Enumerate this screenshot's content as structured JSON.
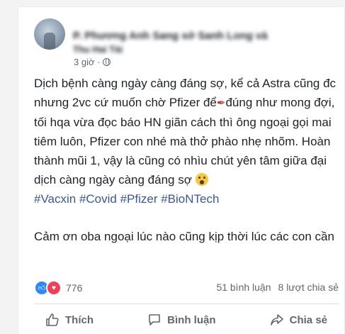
{
  "post": {
    "author_line1": "P. Phương Anh Sang sở Sanh Long và",
    "author_line2": "Thu Hai Tài",
    "time": "3 giờ ·",
    "paragraph1": "Dịch bệnh càng ngày càng đáng sợ, kể cả Astra cũng đc nhưng 2vc cứ muốn chờ Pfizer để",
    "paragraph1b": "đúng như mong đợi, tối hqa vừa đọc báo HN giãn cách thì ông ngoại gọi mai tiêm luôn, Pfizer con nhé mà thở phào nhẹ nhõm. Hoàn thành mũi 1, vậy là cũng có nhìu chút yên tâm giữa đại dịch càng ngày càng đáng sợ",
    "hashtags": "#Vacxin #Covid #Pfizer #BioNTech",
    "paragraph2": "Cảm ơn oba ngoại lúc nào cũng kịp thời lúc các con cần",
    "icons": [
      "globe-icon",
      "syringe-icon",
      "surprised-emoji-icon"
    ]
  },
  "stats": {
    "reaction_count": "776",
    "comments": "51 bình luận",
    "shares": "8 lượt chia sẻ",
    "icons": [
      "like-reaction-icon",
      "love-reaction-icon"
    ]
  },
  "actions": {
    "like": "Thích",
    "comment": "Bình luận",
    "share": "Chia sẻ",
    "icons": [
      "thumbs-up-icon",
      "comment-icon",
      "share-icon"
    ]
  },
  "colors": {
    "hashtag": "#385898",
    "like": "#2d88ff",
    "love": "#f33e58"
  }
}
